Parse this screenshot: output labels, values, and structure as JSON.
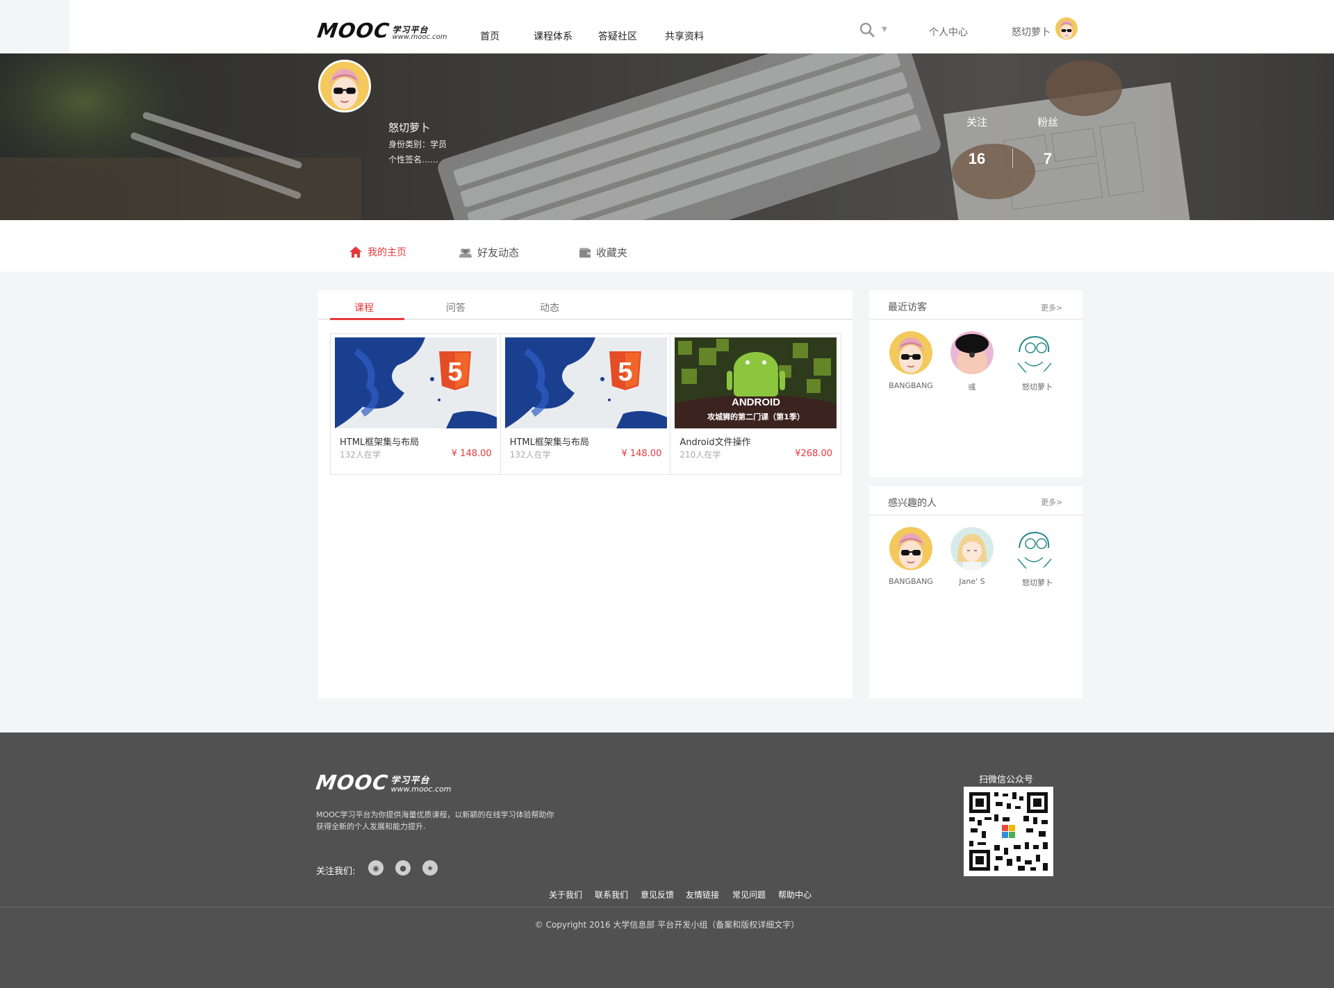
{
  "header": {
    "logo": {
      "text": "MOOC",
      "cn": "学习平台",
      "url": "www.mooc.com"
    },
    "nav": [
      "首页",
      "课程体系",
      "答疑社区",
      "共享资料"
    ],
    "personal_center": "个人中心",
    "username": "怒切萝卜"
  },
  "profile": {
    "name": "怒切萝卜",
    "identity": "身份类别：学员",
    "signature": "个性签名……",
    "following_label": "关注",
    "following": "16",
    "followers_label": "粉丝",
    "followers": "7"
  },
  "tabs": [
    "我的主页",
    "好友动态",
    "收藏夹"
  ],
  "subtabs": [
    "课程",
    "问答",
    "动态"
  ],
  "courses": [
    {
      "title": "HTML框架集与布局",
      "learners": "132人在学",
      "price": "¥ 148.00",
      "image": "html5"
    },
    {
      "title": "HTML框架集与布局",
      "learners": "132人在学",
      "price": "¥ 148.00",
      "image": "html5"
    },
    {
      "title": "Android文件操作",
      "learners": "210人在学",
      "price": "¥268.00",
      "image": "android",
      "overlay": "ANDROID",
      "caption": "攻城狮的第二门课（第1季）"
    }
  ],
  "visitors": {
    "title": "最近访客",
    "more": "更多>",
    "users": [
      "BANGBANG",
      "彧",
      "怒切萝卜"
    ]
  },
  "interested": {
    "title": "感兴趣的人",
    "more": "更多>",
    "users": [
      "BANGBANG",
      "Jane' S",
      "怒切萝卜"
    ]
  },
  "footer": {
    "logo": {
      "text": "MOOC",
      "cn": "学习平台",
      "url": "www.mooc.com"
    },
    "desc_line1": "MOOC学习平台为你提供海量优质课程，以新颖的在线学习体验帮助你",
    "desc_line2": "获得全新的个人发展和能力提升.",
    "follow": "关注我们:",
    "social_icons": [
      "weibo-icon",
      "wechat-icon",
      "qzone-icon"
    ],
    "qr_label": "扫微信公众号",
    "links": [
      "关于我们",
      "联系我们",
      "意见反馈",
      "友情链接",
      "常见问题",
      "帮助中心"
    ],
    "copyright": "© Copyright 2016 大学信息部 平台开发小组（备案和版权详细文字）"
  },
  "colors": {
    "accent": "#e4393c",
    "footer_bg": "#515151",
    "page_bg": "#f4f5f7"
  }
}
